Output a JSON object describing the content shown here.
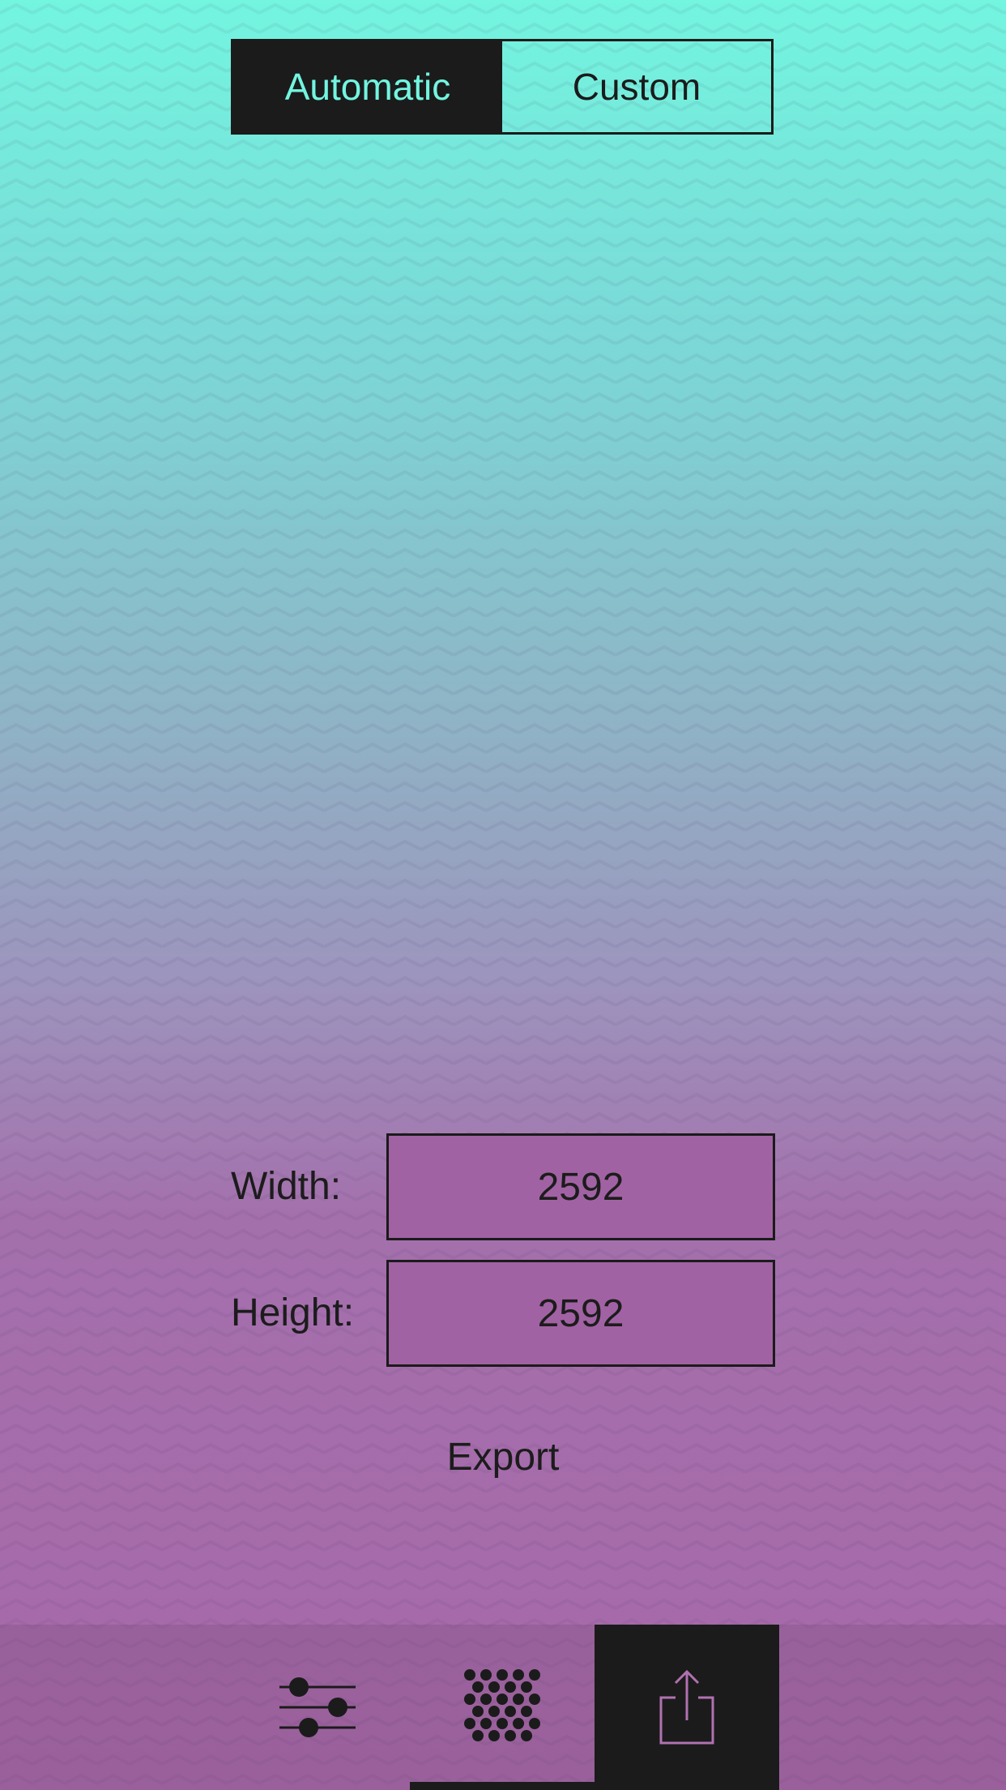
{
  "mode_selector": {
    "automatic_label": "Automatic",
    "custom_label": "Custom",
    "selected": "Automatic"
  },
  "export_panel": {
    "width_label": "Width:",
    "width_value": "2592",
    "height_label": "Height:",
    "height_value": "2592",
    "export_label": "Export"
  },
  "tab_bar": {
    "tabs": [
      {
        "icon": "sliders-icon"
      },
      {
        "icon": "dot-pattern-icon"
      },
      {
        "icon": "share-icon",
        "active": true
      }
    ]
  },
  "colors": {
    "gradient_top": "#73f5e0",
    "gradient_bottom": "#a768a9",
    "dark": "#1b1b1b",
    "share_icon": "#b072b0"
  }
}
